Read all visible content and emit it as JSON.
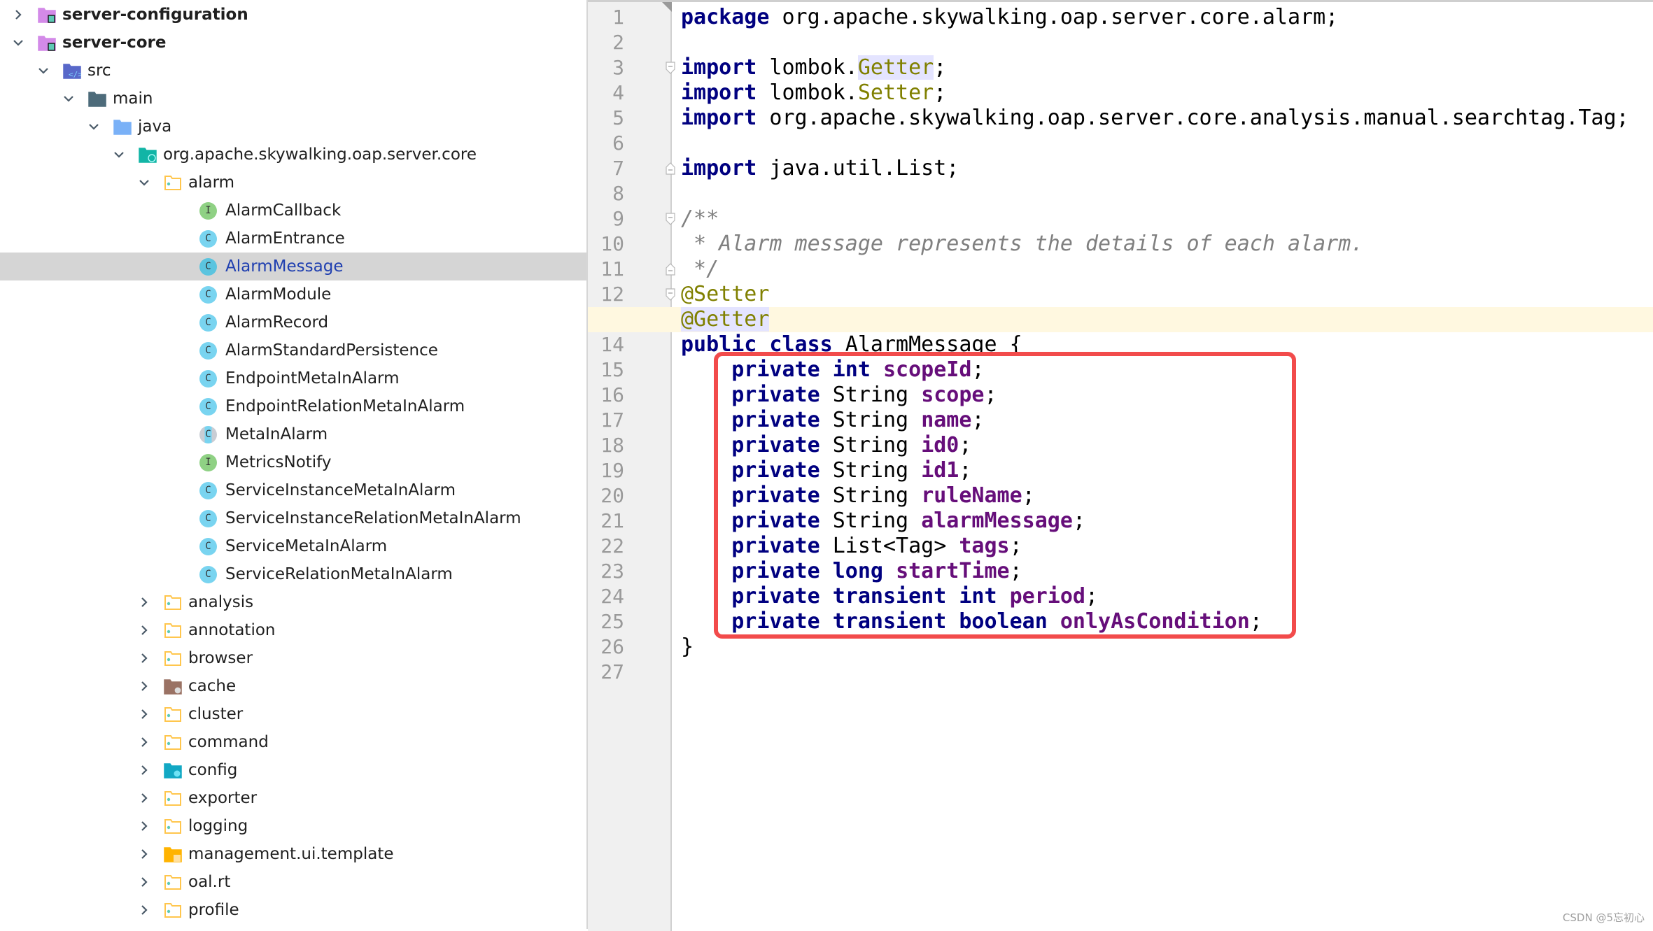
{
  "project_tree": {
    "selected": "AlarmMessage",
    "rows": [
      {
        "label": "server-configuration",
        "level": 0,
        "chevron": "right",
        "icon": "module-folder",
        "bold": true
      },
      {
        "label": "server-core",
        "level": 0,
        "chevron": "down",
        "icon": "module-folder",
        "bold": true
      },
      {
        "label": "src",
        "level": 1,
        "chevron": "down",
        "icon": "source-root-folder"
      },
      {
        "label": "main",
        "level": 2,
        "chevron": "down",
        "icon": "dark-folder"
      },
      {
        "label": "java",
        "level": 3,
        "chevron": "down",
        "icon": "blue-folder"
      },
      {
        "label": "org.apache.skywalking.oap.server.core",
        "level": 4,
        "chevron": "down",
        "icon": "package-teal-folder"
      },
      {
        "label": "alarm",
        "level": 5,
        "chevron": "down",
        "icon": "package-folder"
      },
      {
        "label": "AlarmCallback",
        "level": 6,
        "chevron": "none",
        "icon": "interface",
        "badge": "I"
      },
      {
        "label": "AlarmEntrance",
        "level": 6,
        "chevron": "none",
        "icon": "class",
        "badge": "C"
      },
      {
        "label": "AlarmMessage",
        "level": 6,
        "chevron": "none",
        "icon": "class",
        "badge": "C",
        "selected": true
      },
      {
        "label": "AlarmModule",
        "level": 6,
        "chevron": "none",
        "icon": "class",
        "badge": "C"
      },
      {
        "label": "AlarmRecord",
        "level": 6,
        "chevron": "none",
        "icon": "class",
        "badge": "C"
      },
      {
        "label": "AlarmStandardPersistence",
        "level": 6,
        "chevron": "none",
        "icon": "class",
        "badge": "C"
      },
      {
        "label": "EndpointMetaInAlarm",
        "level": 6,
        "chevron": "none",
        "icon": "class",
        "badge": "C"
      },
      {
        "label": "EndpointRelationMetaInAlarm",
        "level": 6,
        "chevron": "none",
        "icon": "class",
        "badge": "C"
      },
      {
        "label": "MetaInAlarm",
        "level": 6,
        "chevron": "none",
        "icon": "abstract-class",
        "badge": "C"
      },
      {
        "label": "MetricsNotify",
        "level": 6,
        "chevron": "none",
        "icon": "interface",
        "badge": "I"
      },
      {
        "label": "ServiceInstanceMetaInAlarm",
        "level": 6,
        "chevron": "none",
        "icon": "class",
        "badge": "C"
      },
      {
        "label": "ServiceInstanceRelationMetaInAlarm",
        "level": 6,
        "chevron": "none",
        "icon": "class",
        "badge": "C"
      },
      {
        "label": "ServiceMetaInAlarm",
        "level": 6,
        "chevron": "none",
        "icon": "class",
        "badge": "C"
      },
      {
        "label": "ServiceRelationMetaInAlarm",
        "level": 6,
        "chevron": "none",
        "icon": "class",
        "badge": "C"
      },
      {
        "label": "analysis",
        "level": 5,
        "chevron": "right",
        "icon": "package-folder"
      },
      {
        "label": "annotation",
        "level": 5,
        "chevron": "right",
        "icon": "package-folder"
      },
      {
        "label": "browser",
        "level": 5,
        "chevron": "right",
        "icon": "package-folder"
      },
      {
        "label": "cache",
        "level": 5,
        "chevron": "right",
        "icon": "cache-folder"
      },
      {
        "label": "cluster",
        "level": 5,
        "chevron": "right",
        "icon": "package-folder"
      },
      {
        "label": "command",
        "level": 5,
        "chevron": "right",
        "icon": "package-folder"
      },
      {
        "label": "config",
        "level": 5,
        "chevron": "right",
        "icon": "config-folder"
      },
      {
        "label": "exporter",
        "level": 5,
        "chevron": "right",
        "icon": "package-folder"
      },
      {
        "label": "logging",
        "level": 5,
        "chevron": "right",
        "icon": "package-folder"
      },
      {
        "label": "management.ui.template",
        "level": 5,
        "chevron": "right",
        "icon": "template-folder"
      },
      {
        "label": "oal.rt",
        "level": 5,
        "chevron": "right",
        "icon": "package-folder"
      },
      {
        "label": "profile",
        "level": 5,
        "chevron": "right",
        "icon": "package-folder"
      }
    ]
  },
  "editor": {
    "file": "AlarmMessage",
    "current_line": 13,
    "highlight_box_lines": [
      15,
      25
    ],
    "highlight_box_color": "#f24b4b",
    "fold_markers": [
      3,
      7,
      9,
      11,
      12,
      13
    ],
    "lines": [
      [
        {
          "t": "package",
          "c": "kw"
        },
        {
          "t": " org.apache.skywalking.oap.server.core.alarm;"
        }
      ],
      [],
      [
        {
          "t": "import",
          "c": "kw"
        },
        {
          "t": " lombok."
        },
        {
          "t": "Getter",
          "c": "ann hl"
        },
        {
          "t": ";"
        }
      ],
      [
        {
          "t": "import",
          "c": "kw"
        },
        {
          "t": " lombok."
        },
        {
          "t": "Setter",
          "c": "ann"
        },
        {
          "t": ";"
        }
      ],
      [
        {
          "t": "import",
          "c": "kw"
        },
        {
          "t": " org.apache.skywalking.oap.server.core.analysis.manual.searchtag.Tag;"
        }
      ],
      [],
      [
        {
          "t": "import",
          "c": "kw"
        },
        {
          "t": " java.util.List;"
        }
      ],
      [],
      [
        {
          "t": "/**",
          "c": "cmt"
        }
      ],
      [
        {
          "t": " * Alarm message represents the details of each alarm.",
          "c": "cmt"
        }
      ],
      [
        {
          "t": " */",
          "c": "cmt"
        }
      ],
      [
        {
          "t": "@Setter",
          "c": "ann"
        }
      ],
      [
        {
          "t": "@Getter",
          "c": "ann hl"
        }
      ],
      [
        {
          "t": "public class",
          "c": "kw"
        },
        {
          "t": " AlarmMessage {"
        }
      ],
      [
        {
          "t": "    "
        },
        {
          "t": "private int",
          "c": "kw"
        },
        {
          "t": " "
        },
        {
          "t": "scopeId",
          "c": "field"
        },
        {
          "t": ";"
        }
      ],
      [
        {
          "t": "    "
        },
        {
          "t": "private",
          "c": "kw"
        },
        {
          "t": " String "
        },
        {
          "t": "scope",
          "c": "field"
        },
        {
          "t": ";"
        }
      ],
      [
        {
          "t": "    "
        },
        {
          "t": "private",
          "c": "kw"
        },
        {
          "t": " String "
        },
        {
          "t": "name",
          "c": "field"
        },
        {
          "t": ";"
        }
      ],
      [
        {
          "t": "    "
        },
        {
          "t": "private",
          "c": "kw"
        },
        {
          "t": " String "
        },
        {
          "t": "id0",
          "c": "field"
        },
        {
          "t": ";"
        }
      ],
      [
        {
          "t": "    "
        },
        {
          "t": "private",
          "c": "kw"
        },
        {
          "t": " String "
        },
        {
          "t": "id1",
          "c": "field"
        },
        {
          "t": ";"
        }
      ],
      [
        {
          "t": "    "
        },
        {
          "t": "private",
          "c": "kw"
        },
        {
          "t": " String "
        },
        {
          "t": "ruleName",
          "c": "field"
        },
        {
          "t": ";"
        }
      ],
      [
        {
          "t": "    "
        },
        {
          "t": "private",
          "c": "kw"
        },
        {
          "t": " String "
        },
        {
          "t": "alarmMessage",
          "c": "field"
        },
        {
          "t": ";"
        }
      ],
      [
        {
          "t": "    "
        },
        {
          "t": "private",
          "c": "kw"
        },
        {
          "t": " List<Tag> "
        },
        {
          "t": "tags",
          "c": "field"
        },
        {
          "t": ";"
        }
      ],
      [
        {
          "t": "    "
        },
        {
          "t": "private long",
          "c": "kw"
        },
        {
          "t": " "
        },
        {
          "t": "startTime",
          "c": "field"
        },
        {
          "t": ";"
        }
      ],
      [
        {
          "t": "    "
        },
        {
          "t": "private transient int",
          "c": "kw"
        },
        {
          "t": " "
        },
        {
          "t": "period",
          "c": "field"
        },
        {
          "t": ";"
        }
      ],
      [
        {
          "t": "    "
        },
        {
          "t": "private transient boolean",
          "c": "kw"
        },
        {
          "t": " "
        },
        {
          "t": "onlyAsCondition",
          "c": "field"
        },
        {
          "t": ";"
        }
      ],
      [
        {
          "t": "}"
        }
      ],
      []
    ]
  },
  "watermark": "CSDN @5忘初心"
}
